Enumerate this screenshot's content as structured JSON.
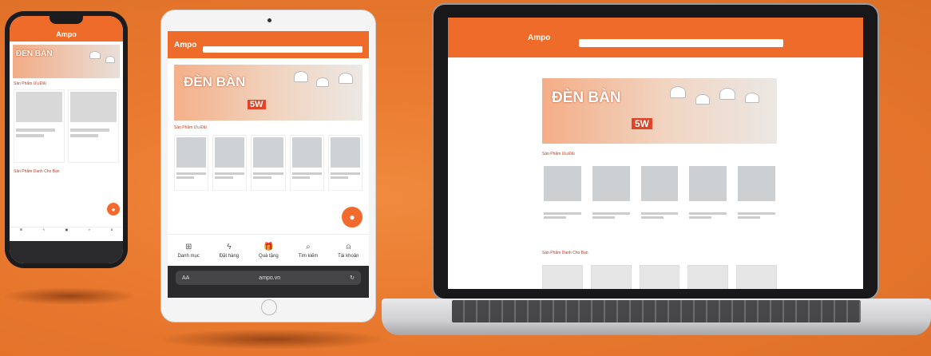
{
  "brand": {
    "name": "Ampo",
    "accent": "#ef6b2a",
    "background": "#e9792f"
  },
  "banner": {
    "headline": "ĐÈN BÀN",
    "promo_price": "5W"
  },
  "sections": {
    "featured": "Sản Phẩm Ưu Đãi",
    "by_category": "Sản Phẩm Danh Cho Bạn"
  },
  "tablet": {
    "nav": [
      {
        "label": "Danh mục",
        "icon": "grid-icon",
        "glyph": "⊞"
      },
      {
        "label": "Đặt hàng",
        "icon": "bolt-icon",
        "glyph": "ϟ"
      },
      {
        "label": "Quà tặng",
        "icon": "gift-icon",
        "glyph": "🎁"
      },
      {
        "label": "Tìm kiếm",
        "icon": "search-icon",
        "glyph": "⌕"
      },
      {
        "label": "Tài khoản",
        "icon": "user-icon",
        "glyph": "⍝"
      }
    ],
    "url": "ampo.vn",
    "text_size_label": "AA"
  }
}
